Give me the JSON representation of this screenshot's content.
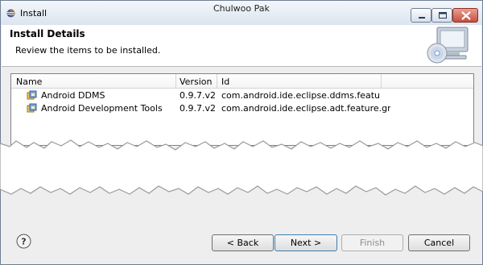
{
  "window": {
    "title": "Install",
    "user": "Chulwoo Pak",
    "controls": [
      "minimize-icon",
      "maximize-icon",
      "close-icon"
    ]
  },
  "header": {
    "title": "Install Details",
    "subtitle": "Review the items to be installed.",
    "icon": "install-cd-monitor-icon"
  },
  "table": {
    "columns": [
      "Name",
      "Version",
      "Id"
    ],
    "rows": [
      {
        "name": "Android DDMS",
        "version": "0.9.7.v2...",
        "id": "com.android.ide.eclipse.ddms.feature.gro..."
      },
      {
        "name": "Android Development Tools",
        "version": "0.9.7.v2...",
        "id": "com.android.ide.eclipse.adt.feature.group"
      }
    ],
    "row_icon": "feature-plugin-icon"
  },
  "footer": {
    "help_icon": "help-icon",
    "back_label": "< Back",
    "next_label": "Next >",
    "finish_label": "Finish",
    "cancel_label": "Cancel"
  }
}
